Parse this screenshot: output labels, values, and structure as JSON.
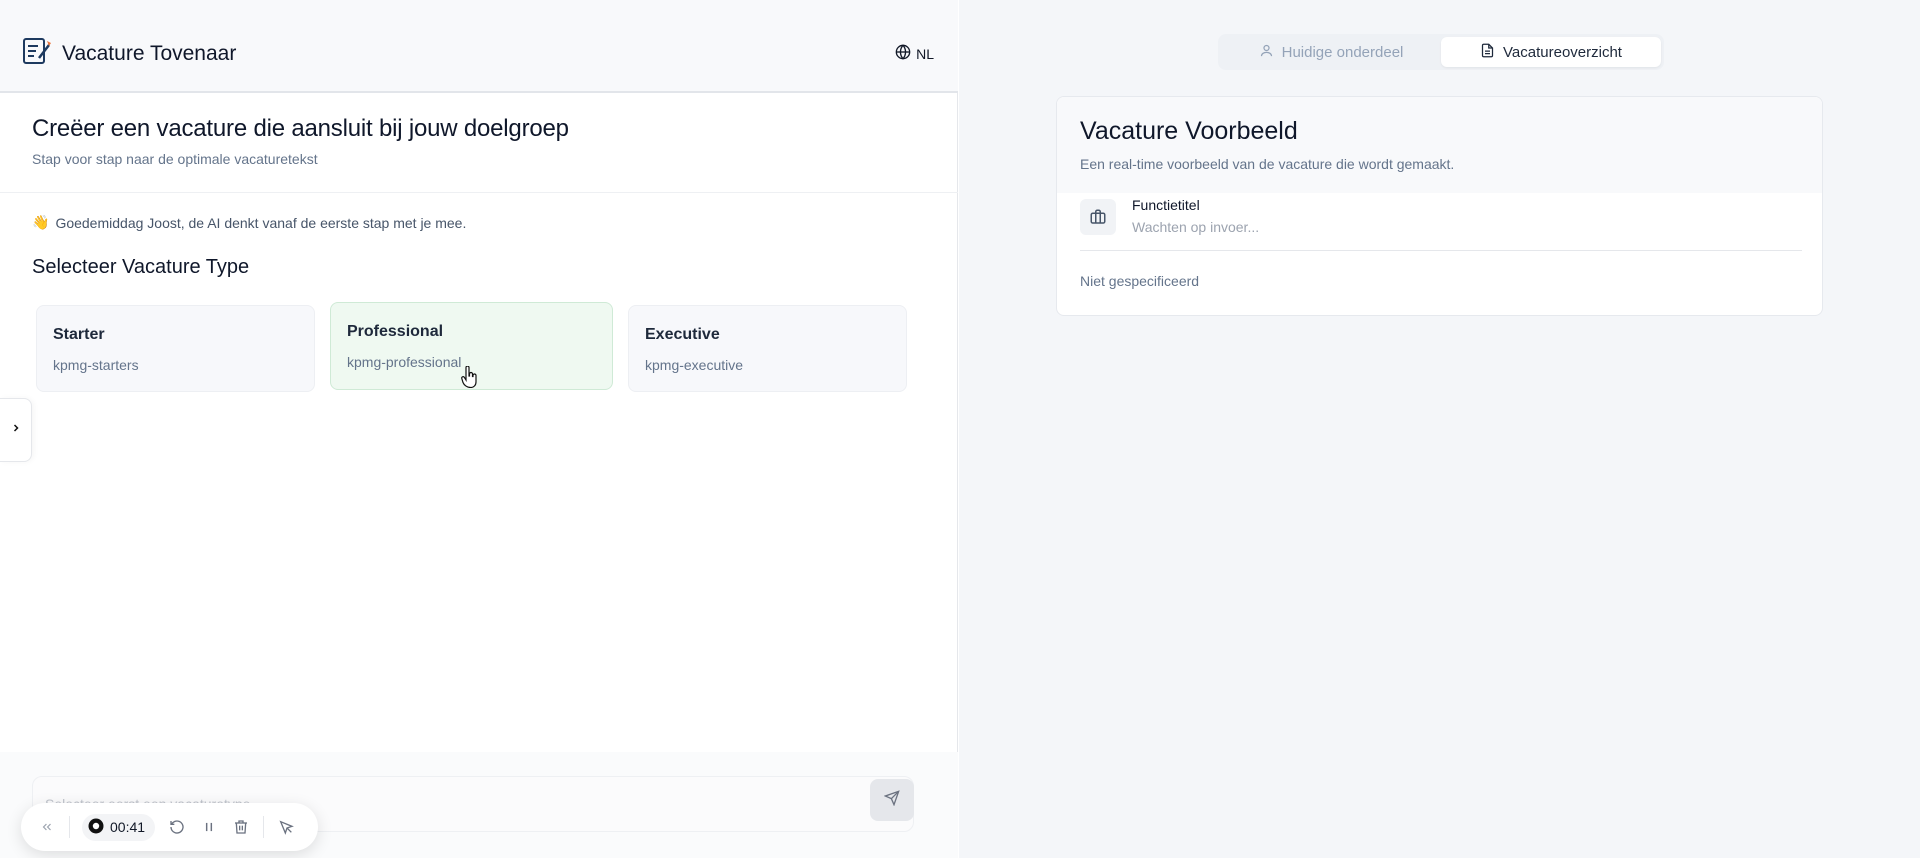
{
  "app": {
    "title": "Vacature Tovenaar",
    "language": "NL"
  },
  "hero": {
    "title": "Creëer een vacature die aansluit bij jouw doelgroep",
    "subtitle": "Stap voor stap naar de optimale vacaturetekst"
  },
  "chat": {
    "greeting_emoji": "👋",
    "greeting": "Goedemiddag Joost, de AI denkt vanaf de eerste stap met je mee.",
    "section_title": "Selecteer Vacature Type",
    "input_placeholder": "Selecteer eerst een vacaturetype"
  },
  "vacancy_types": [
    {
      "title": "Starter",
      "code": "kpmg-starters",
      "selected": false
    },
    {
      "title": "Professional",
      "code": "kpmg-professional",
      "selected": true
    },
    {
      "title": "Executive",
      "code": "kpmg-executive",
      "selected": false
    }
  ],
  "recorder": {
    "time": "00:41"
  },
  "tabs": [
    {
      "label": "Huidige onderdeel",
      "icon": "user-icon",
      "active": false
    },
    {
      "label": "Vacatureoverzicht",
      "icon": "document-icon",
      "active": true
    }
  ],
  "preview": {
    "title": "Vacature Voorbeeld",
    "subtitle": "Een real-time voorbeeld van de vacature die wordt gemaakt.",
    "field_label": "Functietitel",
    "field_value": "Wachten op invoer...",
    "not_specified": "Niet gespecificeerd"
  },
  "colors": {
    "selected_card_bg": "#eff9f1",
    "selected_card_border": "#cfead6",
    "brand_accent": "#e8743b"
  }
}
